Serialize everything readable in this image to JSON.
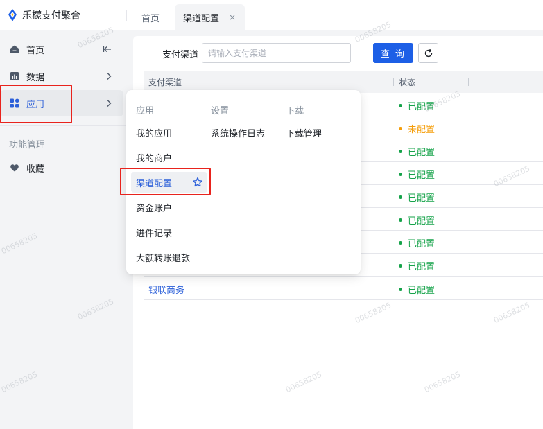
{
  "brand": {
    "name": "乐檬支付聚合",
    "accent": "#1d5fe6"
  },
  "tabs": [
    {
      "label": "首页"
    },
    {
      "label": "渠道配置",
      "close": "×"
    }
  ],
  "sidebar": {
    "items": [
      {
        "label": "首页",
        "icon": "home-icon",
        "trailing": "collapse-icon"
      },
      {
        "label": "数据",
        "icon": "chart-icon",
        "trailing": "chevron-right-icon"
      },
      {
        "label": "应用",
        "icon": "apps-grid-icon",
        "trailing": "chevron-right-icon"
      }
    ],
    "group_label": "功能管理",
    "favorites": {
      "label": "收藏",
      "icon": "heart-icon"
    }
  },
  "flyout": {
    "columns": [
      {
        "header": "应用",
        "items": [
          "我的应用",
          "我的商户",
          "渠道配置",
          "资金账户",
          "进件记录",
          "大额转账退款"
        ]
      },
      {
        "header": "设置",
        "items": [
          "系统操作日志"
        ]
      },
      {
        "header": "下载",
        "items": [
          "下载管理"
        ]
      }
    ]
  },
  "search": {
    "label": "支付渠道",
    "placeholder": "请输入支付渠道",
    "query_label": "查 询"
  },
  "table": {
    "headers": {
      "channel": "支付渠道",
      "status": "状态"
    },
    "rows": [
      {
        "name": "",
        "status": "已配置",
        "state": "ok"
      },
      {
        "name": "",
        "status": "未配置",
        "state": "warn"
      },
      {
        "name": "",
        "status": "已配置",
        "state": "ok"
      },
      {
        "name": "",
        "status": "已配置",
        "state": "ok"
      },
      {
        "name": "",
        "status": "已配置",
        "state": "ok"
      },
      {
        "name": "",
        "status": "已配置",
        "state": "ok"
      },
      {
        "name": "",
        "status": "已配置",
        "state": "ok"
      },
      {
        "name": "",
        "status": "已配置",
        "state": "ok"
      },
      {
        "name": "银联商务",
        "status": "已配置",
        "state": "ok"
      }
    ]
  },
  "colors": {
    "ok": "#16a34a",
    "warn": "#f59e0b",
    "link": "#2b5fd9",
    "highlight": "#e8231d"
  },
  "watermark": "00658205"
}
